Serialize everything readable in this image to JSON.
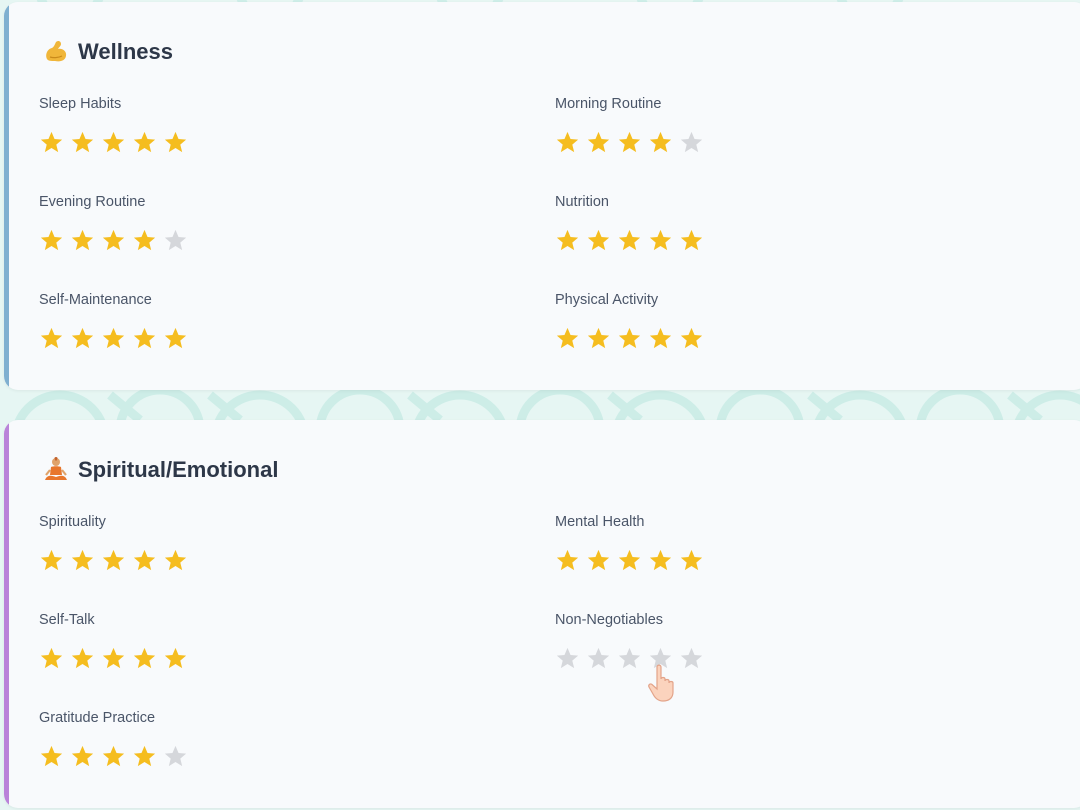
{
  "colors": {
    "star_on": "#f5bd1f",
    "star_off": "#d5d7db",
    "wellness_accent": "#7fb0d0",
    "spiritual_accent": "#b983d9"
  },
  "cards": [
    {
      "id": "wellness",
      "icon": "flexed-biceps-icon",
      "title": "Wellness",
      "items": [
        {
          "label": "Sleep Habits",
          "rating": 5,
          "max": 5
        },
        {
          "label": "Morning Routine",
          "rating": 4,
          "max": 5
        },
        {
          "label": "Evening Routine",
          "rating": 4,
          "max": 5
        },
        {
          "label": "Nutrition",
          "rating": 5,
          "max": 5
        },
        {
          "label": "Self-Maintenance",
          "rating": 5,
          "max": 5
        },
        {
          "label": "Physical Activity",
          "rating": 5,
          "max": 5
        }
      ]
    },
    {
      "id": "spiritual",
      "icon": "meditation-icon",
      "title": "Spiritual/Emotional",
      "items": [
        {
          "label": "Spirituality",
          "rating": 5,
          "max": 5
        },
        {
          "label": "Mental Health",
          "rating": 5,
          "max": 5
        },
        {
          "label": "Self-Talk",
          "rating": 5,
          "max": 5
        },
        {
          "label": "Non-Negotiables",
          "rating": 0,
          "max": 5
        },
        {
          "label": "Gratitude Practice",
          "rating": 4,
          "max": 5
        }
      ]
    }
  ],
  "cursor": {
    "icon": "pointer-hand-icon"
  }
}
